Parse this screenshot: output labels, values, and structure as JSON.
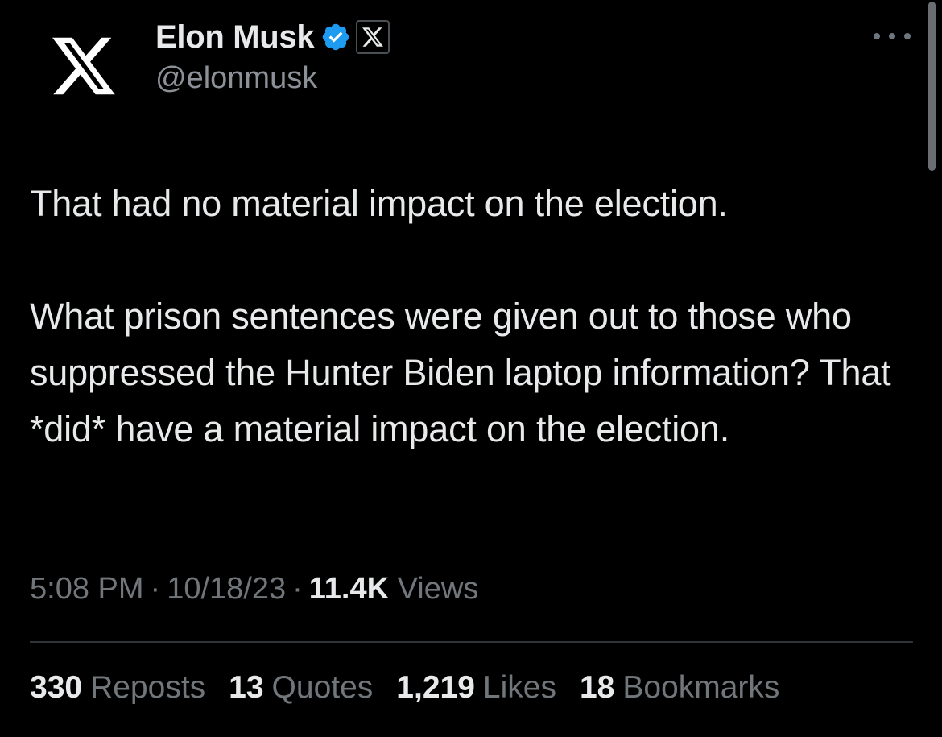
{
  "author": {
    "display_name": "Elon Musk",
    "handle": "@elonmusk",
    "avatar_icon": "x-logo-icon",
    "verified_icon": "verified-badge-icon",
    "affiliation_icon": "x-logo-icon",
    "verified_color": "#1d9bf0"
  },
  "more_icon": "more-options-icon",
  "tweet": {
    "paragraph_1": "That had no material impact on the election.",
    "paragraph_2": "What prison sentences were given out to those who suppressed the Hunter Biden laptop information? That *did* have a material impact on the election."
  },
  "meta": {
    "time": "5:08 PM",
    "separator": "·",
    "date": "10/18/23",
    "views_count": "11.4K",
    "views_label": "Views"
  },
  "stats": {
    "reposts_count": "330",
    "reposts_label": "Reposts",
    "quotes_count": "13",
    "quotes_label": "Quotes",
    "likes_count": "1,219",
    "likes_label": "Likes",
    "bookmarks_count": "18",
    "bookmarks_label": "Bookmarks"
  },
  "colors": {
    "background": "#000000",
    "text_primary": "#e7e9ea",
    "text_secondary": "#71767b",
    "divider": "#2f3336"
  }
}
